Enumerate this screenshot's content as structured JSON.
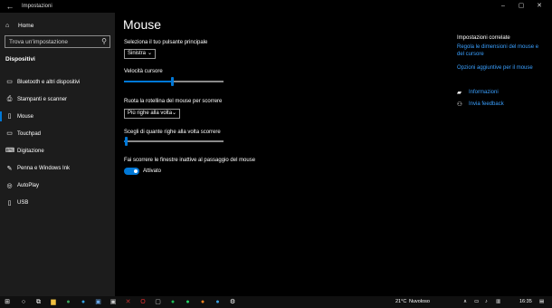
{
  "window": {
    "title": "Impostazioni",
    "back_glyph": "←",
    "controls": {
      "minimize": "–",
      "maximize": "▢",
      "close": "✕"
    }
  },
  "sidebar": {
    "home_label": "Home",
    "home_glyph": "⌂",
    "search_placeholder": "Trova un'impostazione",
    "search_glyph": "⚲",
    "section_title": "Dispositivi",
    "items": [
      {
        "label": "Bluetooth e altri dispositivi",
        "icon": "bluetooth-icon",
        "glyph": "▭"
      },
      {
        "label": "Stampanti e scanner",
        "icon": "printer-icon",
        "glyph": "⎙"
      },
      {
        "label": "Mouse",
        "icon": "mouse-icon",
        "glyph": "▯"
      },
      {
        "label": "Touchpad",
        "icon": "touchpad-icon",
        "glyph": "▭"
      },
      {
        "label": "Digitazione",
        "icon": "keyboard-icon",
        "glyph": "⌨"
      },
      {
        "label": "Penna e Windows Ink",
        "icon": "pen-icon",
        "glyph": "✎"
      },
      {
        "label": "AutoPlay",
        "icon": "autoplay-icon",
        "glyph": "◎"
      },
      {
        "label": "USB",
        "icon": "usb-icon",
        "glyph": "▯"
      }
    ],
    "active_index": 2
  },
  "main": {
    "title": "Mouse",
    "primary_button": {
      "label": "Seleziona il tuo pulsante principale",
      "value": "Sinistra"
    },
    "cursor_speed": {
      "label": "Velocità cursore",
      "level": 0.48
    },
    "wheel_scroll": {
      "label": "Ruota la rotellina del mouse per scorrere",
      "value": "Più righe alla volta"
    },
    "lines_scroll": {
      "label": "Scegli di quante righe alla volta scorrere",
      "level": 0.02
    },
    "inactive_scroll": {
      "label": "Fai scorrere le finestre inattive al passaggio del mouse",
      "state": "Attivato"
    },
    "chevron": "⌄"
  },
  "related": {
    "title": "Impostazioni correlate",
    "links": [
      "Regola le dimensioni del mouse e del cursore",
      "Opzioni aggiuntive per il mouse"
    ],
    "help": [
      {
        "label": "Informazioni",
        "icon": "chat-icon",
        "glyph": "▰"
      },
      {
        "label": "Invia feedback",
        "icon": "feedback-icon",
        "glyph": "⚇"
      }
    ]
  },
  "taskbar": {
    "start_glyph": "⊞",
    "apps": [
      {
        "icon": "search-icon",
        "glyph": "○",
        "color": "#ffffff"
      },
      {
        "icon": "task-view-icon",
        "glyph": "⧉",
        "color": "#ffffff"
      },
      {
        "icon": "explorer-icon",
        "glyph": "▆",
        "color": "#f0c040"
      },
      {
        "icon": "chrome-icon",
        "glyph": "●",
        "color": "#3aa35a"
      },
      {
        "icon": "edge-icon",
        "glyph": "●",
        "color": "#35a0e0"
      },
      {
        "icon": "photos-icon",
        "glyph": "▣",
        "color": "#6aa8e8"
      },
      {
        "icon": "shield-icon",
        "glyph": "▣",
        "color": "#d0d0d0"
      },
      {
        "icon": "filezilla-icon",
        "glyph": "✕",
        "color": "#c03030"
      },
      {
        "icon": "opera-icon",
        "glyph": "O",
        "color": "#e03030"
      },
      {
        "icon": "app-icon",
        "glyph": "▢",
        "color": "#c8c8c8"
      },
      {
        "icon": "spotify-icon",
        "glyph": "●",
        "color": "#1db954"
      },
      {
        "icon": "whatsapp-icon",
        "glyph": "●",
        "color": "#25d366"
      },
      {
        "icon": "vlc-icon",
        "glyph": "●",
        "color": "#f08020"
      },
      {
        "icon": "telegram-icon",
        "glyph": "●",
        "color": "#3aa0e0"
      },
      {
        "icon": "settings-icon",
        "glyph": "⚙",
        "color": "#ffffff"
      }
    ],
    "weather": "21°C",
    "weather_desc": "Nuvoloso",
    "tray_glyphs": [
      "∧",
      "▭",
      "♪",
      "▥"
    ],
    "clock": "16:35",
    "notification_glyph": "▤"
  }
}
